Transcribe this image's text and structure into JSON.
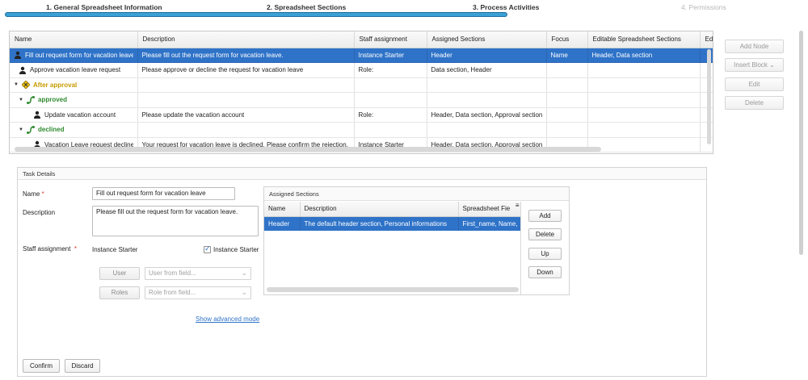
{
  "wizard": {
    "steps": [
      {
        "label": "1. General Spreadsheet Information"
      },
      {
        "label": "2. Spreadsheet Sections"
      },
      {
        "label": "3. Process Activities"
      },
      {
        "label": "4. Permissions"
      }
    ]
  },
  "grid": {
    "columns": [
      "Name",
      "Description",
      "Staff assignment",
      "Assigned Sections",
      "Focus",
      "Editable Spreadsheet Sections",
      "Edi"
    ],
    "rows": [
      {
        "name": "Fill out request form for vacation leave",
        "description": "Please fill out the request form for vacation leave.",
        "staff": "Instance Starter",
        "sections": "Header",
        "focus": "Name",
        "editable": "Header, Data section"
      },
      {
        "name": "Approve vacation leave request",
        "description": "Please approve or decline the request for vacation leave",
        "staff": "Role:",
        "sections": "Data section, Header",
        "focus": "",
        "editable": ""
      },
      {
        "name": "After approval"
      },
      {
        "name": "approved"
      },
      {
        "name": "Update vacation account",
        "description": "Please update the vacation account",
        "staff": "Role:",
        "sections": "Header, Data section, Approval section",
        "focus": "",
        "editable": ""
      },
      {
        "name": "declined"
      },
      {
        "name": "Vacation Leave request declined",
        "description": "Your request for vacation leave is declined. Please confirm the rejection.",
        "staff": "Instance Starter",
        "sections": "Header, Data section, Approval section",
        "focus": "",
        "editable": ""
      }
    ]
  },
  "side_buttons": {
    "add_node": "Add Node",
    "insert_block": "Insert Block ⌄",
    "edit": "Edit",
    "delete": "Delete"
  },
  "task": {
    "title": "Task Details",
    "name_label": "Name",
    "name_value": "Fill out request form for vacation leave",
    "description_label": "Description",
    "description_value": "Please fill out the request form for vacation leave.",
    "staff_label": "Staff assignment",
    "staff_value": "Instance Starter",
    "instance_starter_check": "Instance Starter",
    "user_button": "User",
    "user_field_placeholder": "User from field...",
    "roles_button": "Roles",
    "roles_field_placeholder": "Role from field...",
    "advanced_link": "Show advanced mode",
    "confirm": "Confirm",
    "discard": "Discard"
  },
  "assigned": {
    "title": "Assigned Sections",
    "columns": [
      "Name",
      "Description",
      "Spreadsheet Fie"
    ],
    "rows": [
      {
        "name": "Header",
        "description": "The default header section, Personal informations",
        "fields": "First_name, Name,"
      }
    ],
    "buttons": {
      "add": "Add",
      "delete": "Delete",
      "up": "Up",
      "down": "Down"
    }
  },
  "colors": {
    "accent": "#2f73c8",
    "wizard_bar": "#3aa0d6",
    "required": "#d83b2b",
    "gateway": "#c79b00",
    "branch": "#2f8a2f"
  },
  "icons": [
    "person-icon",
    "gateway-diamond-icon",
    "branch-icon",
    "checkbox-checked-icon",
    "chevron-down-icon",
    "column-menu-icon"
  ]
}
